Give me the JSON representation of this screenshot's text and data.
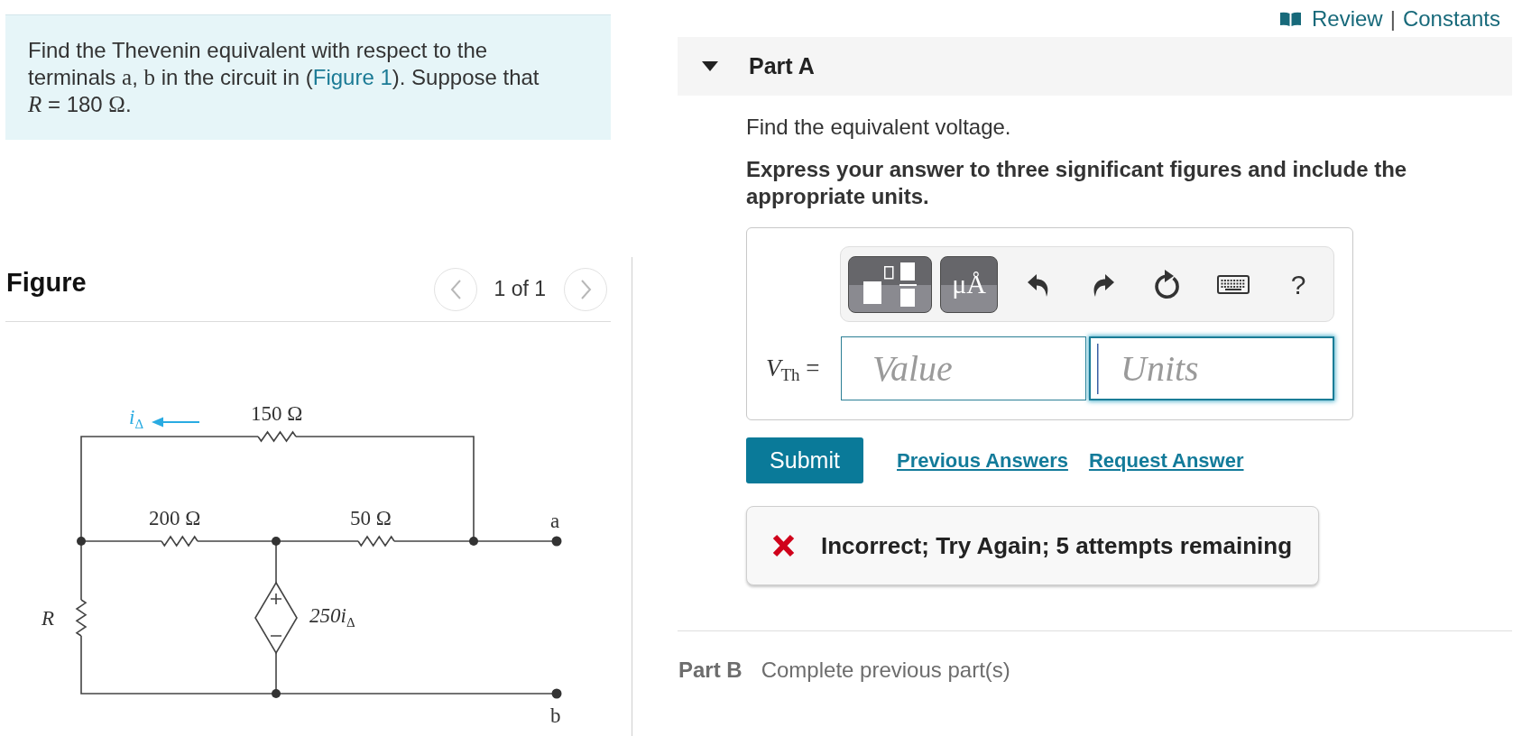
{
  "problem": {
    "segments": [
      {
        "kind": "text",
        "text": "Find the Thevenin equivalent with respect to the terminals "
      },
      {
        "kind": "math",
        "text": "a"
      },
      {
        "kind": "text",
        "text": ", "
      },
      {
        "kind": "math",
        "text": "b"
      },
      {
        "kind": "text",
        "text": " in the circuit in ("
      },
      {
        "kind": "link",
        "text": "Figure 1"
      },
      {
        "kind": "text",
        "text": "). Suppose that "
      },
      {
        "kind": "var",
        "text": "R"
      },
      {
        "kind": "text",
        "text": " = 180 "
      },
      {
        "kind": "math",
        "text": "Ω"
      },
      {
        "kind": "text",
        "text": "."
      }
    ]
  },
  "figure": {
    "title": "Figure",
    "counter": "1 of 1",
    "circuit": {
      "current": "i$_{Δ}$",
      "resistor_top": "150 Ω",
      "resistor_left": "200 Ω",
      "resistor_right": "50 Ω",
      "resistor_r": "R",
      "source": "250i$_{Δ}$",
      "terminal_a": "a",
      "terminal_b": "b"
    }
  },
  "header_links": {
    "items": [
      "Review",
      "Constants"
    ],
    "separator": "|"
  },
  "part_a": {
    "title": "Part A",
    "expanded": true,
    "prompt": "Find the equivalent voltage.",
    "instruction": "Express your answer to three significant figures and include the appropriate units.",
    "toolbar": [
      {
        "kind": "templates"
      },
      {
        "kind": "units",
        "label": "μÅ"
      },
      {
        "kind": "undo"
      },
      {
        "kind": "redo"
      },
      {
        "kind": "reset"
      },
      {
        "kind": "keyboard"
      },
      {
        "kind": "help",
        "label": "?"
      }
    ],
    "answer": {
      "label": "*V*$_{Th}$ =",
      "value_field": {
        "placeholder": "Value",
        "focused": false
      },
      "units_field": {
        "placeholder": "Units",
        "focused": true
      }
    },
    "submit": "Submit",
    "links": [
      "Previous Answers",
      "Request Answer"
    ],
    "feedback": {
      "kind": "incorrect",
      "text": "Incorrect; Try Again; 5 attempts remaining"
    }
  },
  "part_b": {
    "title": "Part B",
    "note": "Complete previous part(s)"
  }
}
